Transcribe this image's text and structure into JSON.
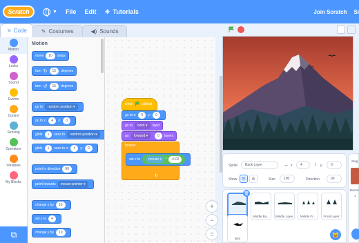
{
  "topbar": {
    "logo": "Scratch",
    "menu": [
      "File",
      "Edit",
      "Tutorials"
    ],
    "right": [
      "Join Scratch",
      "Si"
    ]
  },
  "tabs": [
    {
      "label": "Code",
      "icon": "code-icon"
    },
    {
      "label": "Costumes",
      "icon": "brush-icon"
    },
    {
      "label": "Sounds",
      "icon": "speaker-icon"
    }
  ],
  "categories": [
    {
      "label": "Motion",
      "color": "#4c97ff"
    },
    {
      "label": "Looks",
      "color": "#9966ff"
    },
    {
      "label": "Sound",
      "color": "#cf63cf"
    },
    {
      "label": "Events",
      "color": "#ffbf00"
    },
    {
      "label": "Control",
      "color": "#ffab19"
    },
    {
      "label": "Sensing",
      "color": "#5cb1d6"
    },
    {
      "label": "Operators",
      "color": "#59c059"
    },
    {
      "label": "Variables",
      "color": "#ff8c1a"
    },
    {
      "label": "My Blocks",
      "color": "#ff6680"
    }
  ],
  "palette": {
    "title": "Motion",
    "blocks": {
      "move": {
        "pre": "move",
        "val": "10",
        "post": "steps"
      },
      "turn_right": {
        "pre": "turn",
        "icon": "↻",
        "val": "15",
        "post": "degrees"
      },
      "turn_left": {
        "pre": "turn",
        "icon": "↺",
        "val": "15",
        "post": "degrees"
      },
      "goto_random": {
        "pre": "go to",
        "dd": "random position ▾"
      },
      "goto_xy": {
        "pre": "go to x:",
        "x": "4",
        "ylab": "y:",
        "y": "0"
      },
      "glide_random": {
        "pre": "glide",
        "val": "1",
        "mid": "secs to",
        "dd": "random position ▾"
      },
      "glide_xy": {
        "pre": "glide",
        "val": "1",
        "mid": "secs to x:",
        "x": "4",
        "ylab": "y:",
        "y": "0"
      },
      "point_dir": {
        "pre": "point in direction",
        "val": "90"
      },
      "point_towards": {
        "pre": "point towards",
        "dd": "mouse-pointer ▾"
      },
      "change_x": {
        "pre": "change x by",
        "val": "10"
      },
      "set_x": {
        "pre": "set x to",
        "val": "4"
      },
      "change_y": {
        "pre": "change y by",
        "val": "10"
      }
    }
  },
  "script": {
    "hat": {
      "pre": "when",
      "post": "clicked"
    },
    "goto": {
      "pre": "go to x:",
      "x": "0",
      "ylab": "y:",
      "y": "0"
    },
    "layer": {
      "pre": "go to",
      "dd": "back ▾",
      "post": "layer"
    },
    "forward": {
      "pre": "go",
      "dd": "forward ▾",
      "val": "0",
      "post": "layers"
    },
    "forever": "forever",
    "setx": {
      "pre": "set x to",
      "op": "mouse x",
      "op_sym": "*",
      "val": "-0.02"
    }
  },
  "zoom": {
    "in": "+",
    "out": "−",
    "reset": "="
  },
  "sprite_info": {
    "sprite_label": "Sprite",
    "sprite_name": "Back Layer",
    "x_label": "x",
    "x": "4",
    "y_label": "y",
    "y": "0",
    "show_label": "Show",
    "size_label": "Size",
    "size": "100",
    "direction_label": "Direction",
    "direction": "90"
  },
  "sprites": [
    {
      "name": "Back Layer",
      "selected": true
    },
    {
      "name": "Middle Ba...",
      "selected": false
    },
    {
      "name": "Middle Layer",
      "selected": false
    },
    {
      "name": "Middle Fr...",
      "selected": false
    },
    {
      "name": "Front Layer",
      "selected": false
    },
    {
      "name": "Bird",
      "selected": false
    }
  ],
  "stage_pane": {
    "title": "Stag",
    "backdrops_label": "Backd",
    "count": "1"
  }
}
